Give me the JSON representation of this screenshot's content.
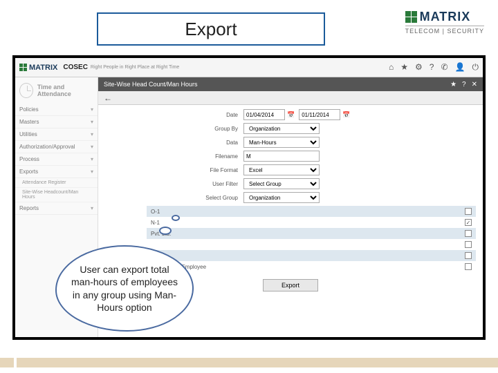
{
  "slide": {
    "title": "Export"
  },
  "brand": {
    "name": "MATRIX",
    "sub": "TELECOM | SECURITY"
  },
  "header": {
    "product": "COSEC",
    "tagline": "Right People in Right Place at Right Time",
    "icons": {
      "home": "⌂",
      "star": "★",
      "gear": "⚙",
      "help": "?",
      "phone": "✆",
      "user": "👤",
      "power": "⏻"
    }
  },
  "module": {
    "title": "Time and Attendance"
  },
  "sidebar": {
    "items": [
      {
        "label": "Policies"
      },
      {
        "label": "Masters"
      },
      {
        "label": "Utilities"
      },
      {
        "label": "Authorization/Approval"
      },
      {
        "label": "Process"
      },
      {
        "label": "Exports"
      }
    ],
    "subs": [
      {
        "label": "Attendance Register"
      },
      {
        "label": "Site-Wise Headcount/Man Hours"
      }
    ],
    "reports": "Reports"
  },
  "breadcrumb": "Site-Wise Head Count/Man Hours",
  "crumb_icons": {
    "star": "★",
    "help": "?",
    "close": "✕"
  },
  "form": {
    "date_label": "Date",
    "date_from": "01/04/2014",
    "date_to": "01/11/2014",
    "groupby_label": "Group By",
    "groupby_value": "Organization",
    "data_label": "Data",
    "data_value": "Man-Hours",
    "filename_label": "Filename",
    "filename_value": "M",
    "fileformat_label": "File Format",
    "fileformat_value": "Excel",
    "filter_label": "User Filter",
    "filter_value": "Select Group",
    "selectgroup_label": "Select Group",
    "selectgroup_value": "Organization"
  },
  "list": {
    "rows": [
      {
        "label": "O-1",
        "checked": false
      },
      {
        "label": "N-1",
        "checked": true
      },
      {
        "label": "Pvt. Ltd.",
        "checked": false
      },
      {
        "label": "",
        "checked": false
      },
      {
        "label": "",
        "checked": false
      },
      {
        "label": "Unassigned Employee",
        "checked": false
      }
    ]
  },
  "buttons": {
    "export": "Export"
  },
  "callout": {
    "text": "User can export total man-hours of employees in any group using Man-Hours option"
  }
}
